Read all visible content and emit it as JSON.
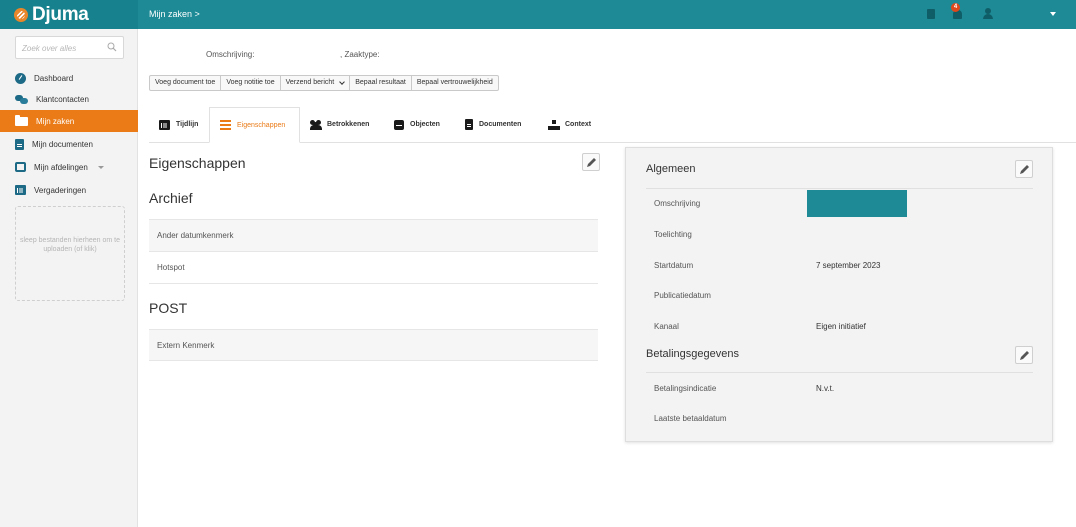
{
  "app": {
    "brand": "Djuma",
    "breadcrumb": "Mijn zaken >",
    "notification_count": "4"
  },
  "colors": {
    "topbar": "#1d8a96",
    "accent": "#ea7b17",
    "badge": "#e0471b"
  },
  "sidebar": {
    "search_placeholder": "Zoek over alles",
    "items": [
      {
        "label": "Dashboard",
        "icon": "dashboard-icon"
      },
      {
        "label": "Klantcontacten",
        "icon": "chat-icon"
      },
      {
        "label": "Mijn zaken",
        "icon": "folder-icon",
        "active": true
      },
      {
        "label": "Mijn documenten",
        "icon": "document-icon"
      },
      {
        "label": "Mijn afdelingen",
        "icon": "inbox-icon",
        "has_dropdown": true
      },
      {
        "label": "Vergaderingen",
        "icon": "calendar-icon"
      }
    ],
    "dropzone_text": "sleep bestanden hierheen om te uploaden (of klik)"
  },
  "header": {
    "omschrijving_label": "Omschrijving:",
    "zaaktype_label": ", Zaaktype:",
    "actions": [
      "Voeg document toe",
      "Voeg notitie toe",
      "Verzend bericht",
      "Bepaal resultaat",
      "Bepaal vertrouwelijkheid"
    ]
  },
  "tabs": [
    {
      "label": "Tijdlijn",
      "icon": "calendar-icon"
    },
    {
      "label": "Eigenschappen",
      "icon": "list-icon",
      "active": true
    },
    {
      "label": "Betrokkenen",
      "icon": "people-icon"
    },
    {
      "label": "Objecten",
      "icon": "cube-icon"
    },
    {
      "label": "Documenten",
      "icon": "document-icon"
    },
    {
      "label": "Context",
      "icon": "sitemap-icon"
    }
  ],
  "eigenschappen": {
    "title": "Eigenschappen",
    "sections": [
      {
        "title": "Archief",
        "rows": [
          "Ander datumkenmerk",
          "Hotspot"
        ]
      },
      {
        "title": "POST",
        "rows": [
          "Extern Kenmerk"
        ]
      }
    ]
  },
  "panel": {
    "algemeen": {
      "title": "Algemeen",
      "rows": [
        {
          "label": "Omschrijving",
          "value": ""
        },
        {
          "label": "Toelichting",
          "value": ""
        },
        {
          "label": "Startdatum",
          "value": "7 september 2023"
        },
        {
          "label": "Publicatiedatum",
          "value": ""
        },
        {
          "label": "Kanaal",
          "value": "Eigen initiatief"
        }
      ]
    },
    "betaling": {
      "title": "Betalingsgegevens",
      "rows": [
        {
          "label": "Betalingsindicatie",
          "value": "N.v.t."
        },
        {
          "label": "Laatste betaaldatum",
          "value": ""
        }
      ]
    }
  }
}
